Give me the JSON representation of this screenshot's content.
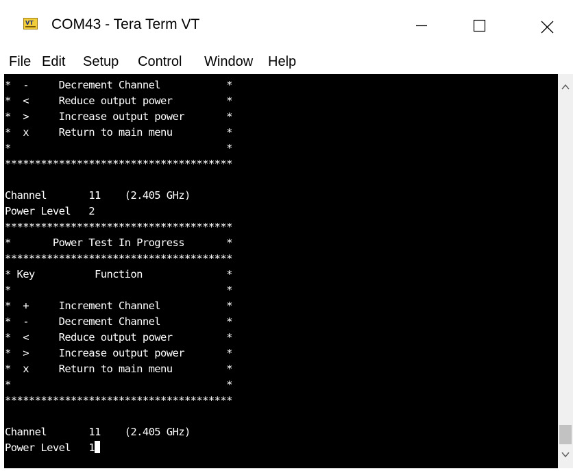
{
  "window": {
    "title": "COM43 - Tera Term VT",
    "app_icon_label": "VT"
  },
  "menu": {
    "items": [
      "File",
      "Edit",
      "Setup",
      "Control",
      "Window",
      "Help"
    ]
  },
  "terminal": {
    "lines": [
      "*  -     Decrement Channel           *",
      "*  <     Reduce output power         *",
      "*  >     Increase output power       *",
      "*  x     Return to main menu         *",
      "*                                    *",
      "**************************************",
      "",
      "Channel       11    (2.405 GHz)",
      "Power Level   2",
      "**************************************",
      "*       Power Test In Progress       *",
      "**************************************",
      "* Key          Function              *",
      "*                                    *",
      "*  +     Increment Channel           *",
      "*  -     Decrement Channel           *",
      "*  <     Reduce output power         *",
      "*  >     Increase output power       *",
      "*  x     Return to main menu         *",
      "*                                    *",
      "**************************************",
      "",
      "Channel       11    (2.405 GHz)"
    ],
    "last_line": "Power Level   1"
  },
  "icons": {
    "minimize": "minimize-icon",
    "maximize": "maximize-icon",
    "close": "close-icon",
    "scroll_up": "scroll-up-arrow-icon",
    "scroll_down": "scroll-down-arrow-icon"
  },
  "colors": {
    "terminal_background": "#000000",
    "terminal_text": "#ffffff",
    "window_background": "#ffffff"
  }
}
